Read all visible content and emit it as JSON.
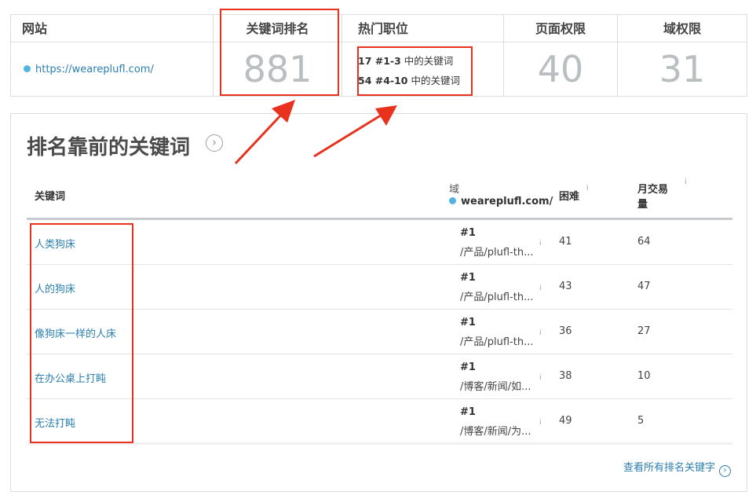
{
  "metrics": {
    "website": {
      "header": "网站",
      "url": "https://weareplufl.com/"
    },
    "keyword_rank": {
      "header": "关键词排名",
      "value": "881"
    },
    "top_positions": {
      "header": "热门职位",
      "line1": {
        "count": "17 #1-3",
        "text": " 中的关键词"
      },
      "line2": {
        "count": "54 #4-10",
        "text": " 中的关键词"
      }
    },
    "page_authority": {
      "header": "页面权限",
      "value": "40"
    },
    "domain_authority": {
      "header": "域权限",
      "value": "31"
    }
  },
  "panel": {
    "title": "排名靠前的关键词",
    "columns": {
      "keyword": "关键词",
      "domain_label": "域",
      "domain": "weareplufl.com/",
      "difficulty": "困难",
      "volume_line1": "月交易",
      "volume_line2": "量"
    },
    "rows": [
      {
        "keyword": "人类狗床",
        "rank": "#1",
        "url": "/产品/plufl-th...",
        "difficulty": "41",
        "volume": "64"
      },
      {
        "keyword": "人的狗床",
        "rank": "#1",
        "url": "/产品/plufl-th...",
        "difficulty": "43",
        "volume": "47"
      },
      {
        "keyword": "像狗床一样的人床",
        "rank": "#1",
        "url": "/产品/plufl-th...",
        "difficulty": "36",
        "volume": "27"
      },
      {
        "keyword": "在办公桌上打盹",
        "rank": "#1",
        "url": "/博客/新闻/如...",
        "difficulty": "38",
        "volume": "10"
      },
      {
        "keyword": "无法打盹",
        "rank": "#1",
        "url": "/博客/新闻/为...",
        "difficulty": "49",
        "volume": "5"
      }
    ],
    "view_all": "查看所有排名关键字"
  },
  "icons": {
    "title_arrow": "chevron-right-circle-icon",
    "info": "info-icon",
    "view_all_arrow": "chevron-right-circle-icon"
  },
  "colors": {
    "link": "#2a7fb0",
    "annotation": "#e8321e",
    "metric": "#b9bec1",
    "dot": "#52b4e0"
  }
}
